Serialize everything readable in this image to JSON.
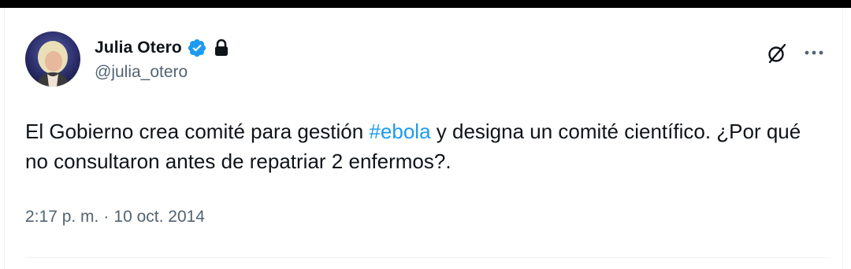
{
  "author": {
    "display_name": "Julia Otero",
    "handle": "@julia_otero",
    "verified": true,
    "protected": true
  },
  "tweet": {
    "text_before": "El Gobierno crea comité para gestión ",
    "hashtag": "#ebola",
    "text_after": " y designa un comité científico. ¿Por qué no consultaron antes de repatriar 2 enfermos?.",
    "time": "2:17 p. m.",
    "separator": "·",
    "date": "10 oct. 2014"
  },
  "actions": {
    "grok_icon": "grok-icon",
    "more_icon": "more-options-icon"
  },
  "colors": {
    "text": "#0f1419",
    "secondary": "#536471",
    "accent": "#1d9bf0",
    "divider": "#eff3f4"
  }
}
